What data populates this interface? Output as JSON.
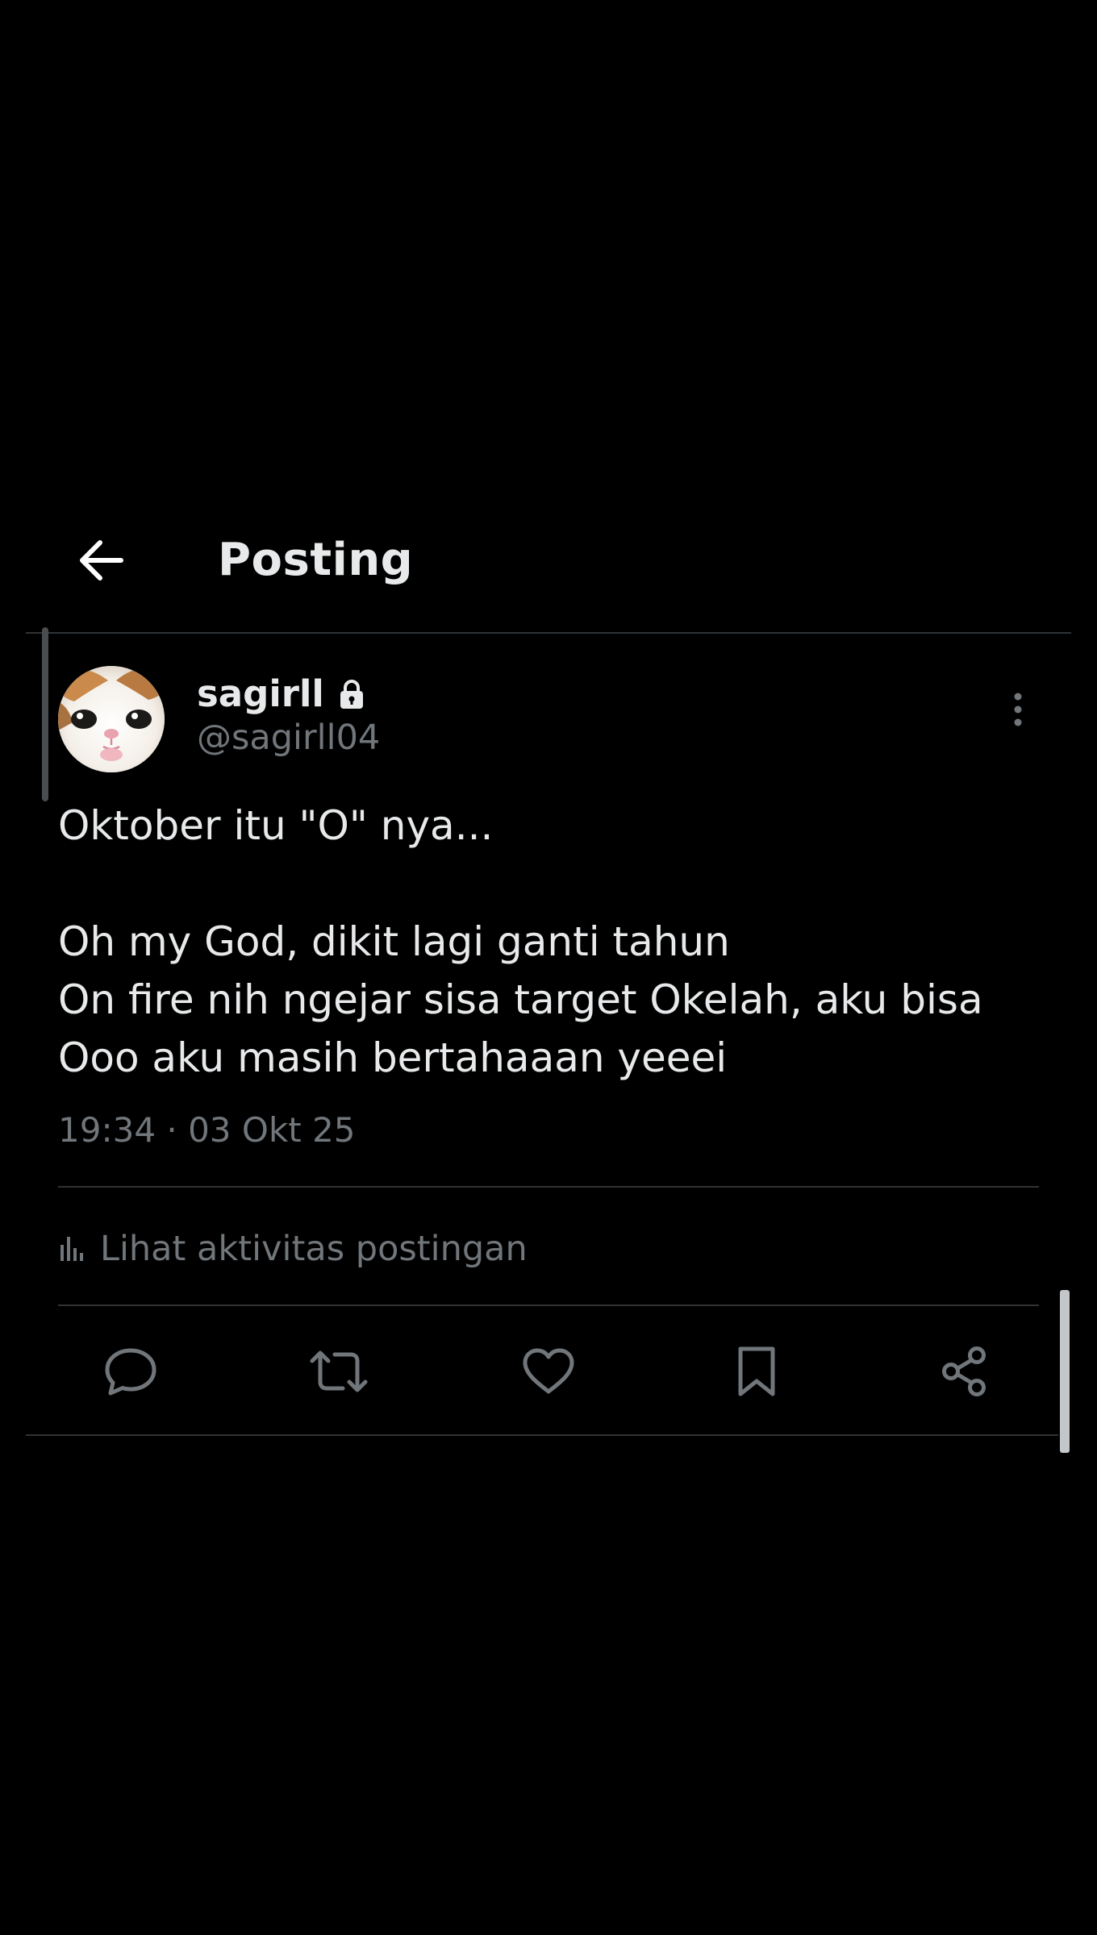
{
  "header": {
    "title": "Posting",
    "back_icon": "arrow-left-icon"
  },
  "post": {
    "author": {
      "display_name": "sagirll",
      "handle": "@sagirll04",
      "protected": true
    },
    "text_lines": [
      "Oktober itu \"O\" nya...",
      "",
      "Oh my God, dikit lagi ganti tahun",
      "On fire nih ngejar sisa target Okelah, aku bisa",
      "Ooo aku masih bertahaaan yeeei"
    ],
    "timestamp": "19:34 · 03 Okt 25",
    "activity_label": "Lihat aktivitas postingan"
  },
  "actions": [
    {
      "name": "reply",
      "icon": "reply-icon"
    },
    {
      "name": "repost",
      "icon": "repost-icon"
    },
    {
      "name": "like",
      "icon": "heart-icon"
    },
    {
      "name": "bookmark",
      "icon": "bookmark-icon"
    },
    {
      "name": "share",
      "icon": "share-icon"
    }
  ],
  "colors": {
    "background": "#000000",
    "primary_text": "#e7e9ea",
    "secondary_text": "#71767b",
    "divider": "#2f3336"
  }
}
